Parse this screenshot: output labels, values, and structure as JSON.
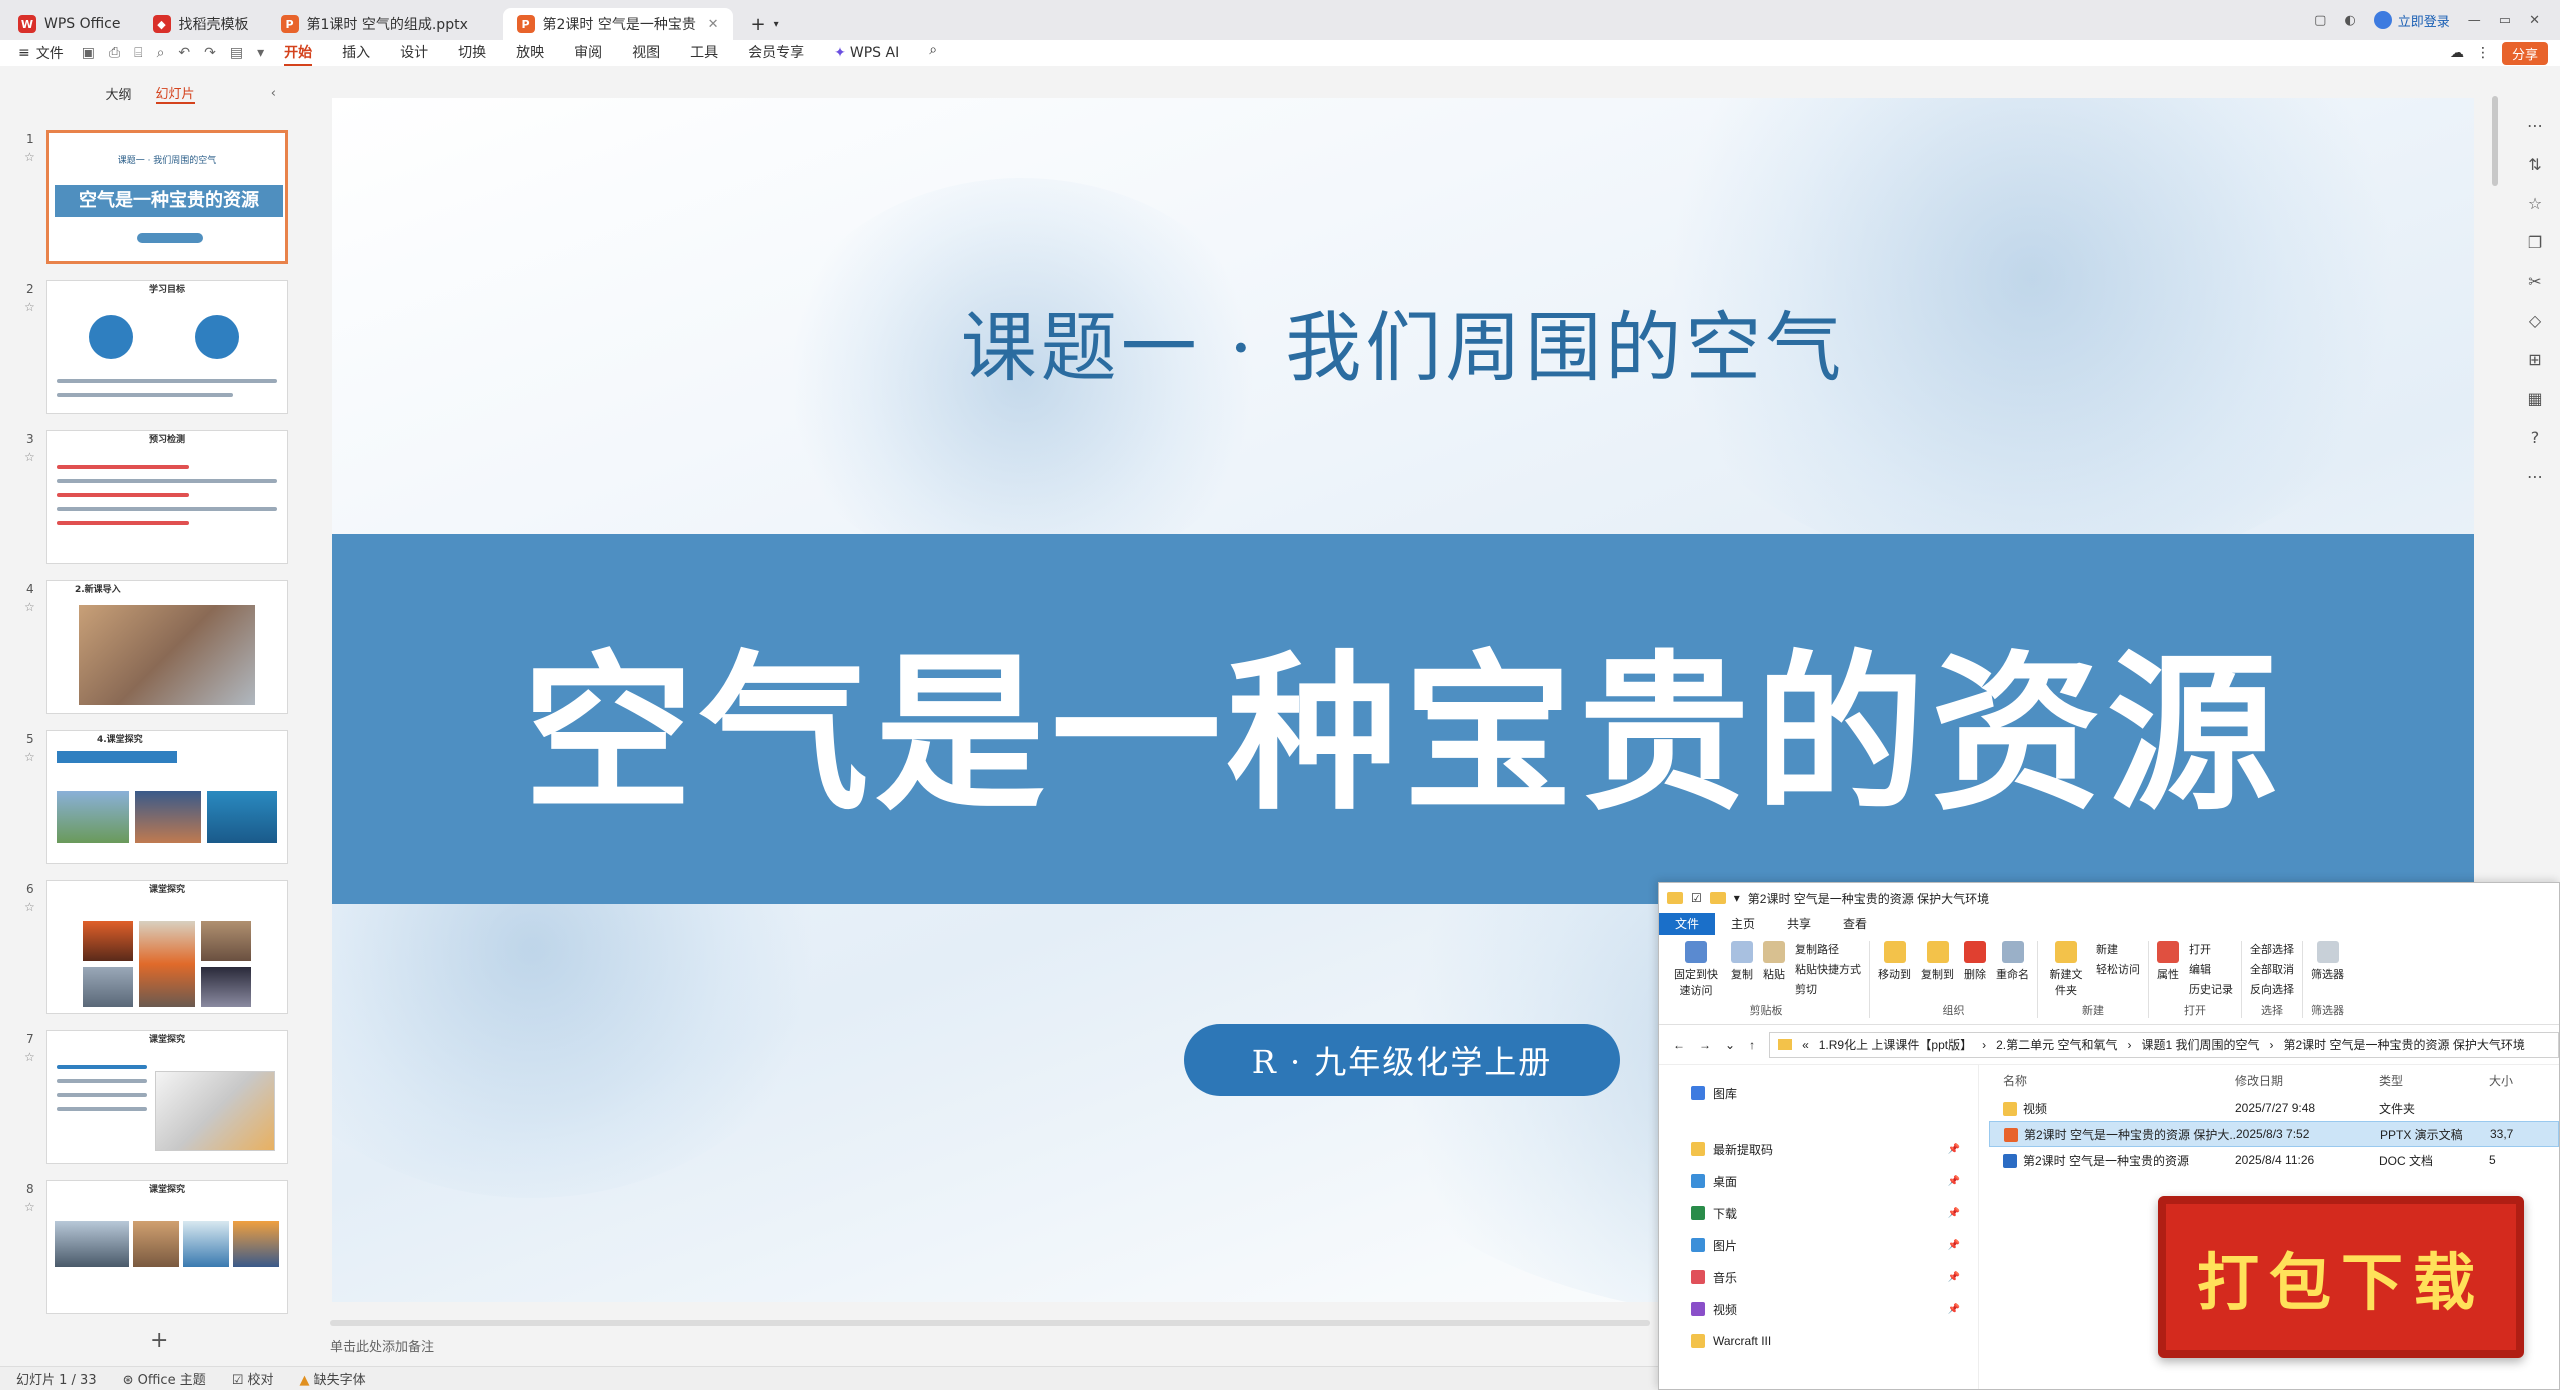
{
  "titlebar": {
    "tabs": [
      {
        "label": "WPS Office",
        "color": "#d9302a",
        "active": false
      },
      {
        "label": "找稻壳模板",
        "color": "#d9302a",
        "active": false
      },
      {
        "label": "第1课时 空气的组成.pptx",
        "color": "#e8632b",
        "active": false
      },
      {
        "label": "第2课时 空气是一种宝贵的资",
        "color": "#e8632b",
        "active": true
      }
    ],
    "new_tab": "+",
    "login": "立即登录"
  },
  "menubar": {
    "file": "文件",
    "tabs": [
      "开始",
      "插入",
      "设计",
      "切换",
      "放映",
      "审阅",
      "视图",
      "工具",
      "会员专享"
    ],
    "active_tab": "开始",
    "ai": "WPS AI",
    "share": "分享"
  },
  "sidebar": {
    "tabs": [
      "大纲",
      "幻灯片"
    ],
    "active": "幻灯片",
    "slides": [
      {
        "num": "1",
        "title": "课题一 · 我们周围的空气",
        "heading": "空气是一种宝贵的资源"
      },
      {
        "num": "2",
        "heading": "学习目标"
      },
      {
        "num": "3",
        "heading": "预习检测"
      },
      {
        "num": "4",
        "heading": "2.新课导入"
      },
      {
        "num": "5",
        "heading": "4.课堂探究"
      },
      {
        "num": "6",
        "heading": "课堂探究"
      },
      {
        "num": "7",
        "heading": "课堂探究"
      },
      {
        "num": "8",
        "heading": "课堂探究"
      }
    ],
    "add": "+"
  },
  "slide": {
    "subtitle": "课题一 · 我们周围的空气",
    "title": "空气是一种宝贵的资源",
    "pill": "R · 九年级化学上册",
    "banner_color": "#4e8fc2",
    "pill_color": "#2d77b7"
  },
  "notes": "单击此处添加备注",
  "statusbar": {
    "page": "幻灯片 1 / 33",
    "theme": "Office 主题",
    "proof": "校对",
    "font": "缺失字体"
  },
  "explorer": {
    "title": "第2课时 空气是一种宝贵的资源 保护大气环境",
    "tabs": [
      "文件",
      "主页",
      "共享",
      "查看"
    ],
    "ribbon": {
      "clipboard": {
        "items": [
          "固定到快速访问",
          "复制",
          "粘贴"
        ],
        "small": [
          "复制路径",
          "粘贴快捷方式",
          "剪切"
        ],
        "label": "剪贴板"
      },
      "organize": {
        "items": [
          "移动到",
          "复制到",
          "删除",
          "重命名"
        ],
        "label": "组织"
      },
      "new": {
        "items": [
          "新建文件夹"
        ],
        "small": [
          "新建",
          "轻松访问"
        ],
        "label": "新建"
      },
      "open": {
        "items": [
          "属性"
        ],
        "small": [
          "打开",
          "编辑",
          "历史记录"
        ],
        "label": "打开"
      },
      "select": {
        "small": [
          "全部选择",
          "全部取消",
          "反向选择"
        ],
        "label": "选择"
      },
      "filter": {
        "items": [
          "筛选器"
        ],
        "label": "筛选器"
      }
    },
    "address": [
      "1.R9化上 上课课件【ppt版】",
      "2.第二单元 空气和氧气",
      "课题1 我们周围的空气",
      "第2课时 空气是一种宝贵的资源 保护大气环境"
    ],
    "nav": [
      {
        "label": "图库",
        "color": "#3d7be0"
      },
      {
        "label": "最新提取码",
        "color": "#f3c24a"
      },
      {
        "label": "桌面",
        "color": "#3b8fd9"
      },
      {
        "label": "下载",
        "color": "#2a8c4a"
      },
      {
        "label": "图片",
        "color": "#3b8fd9"
      },
      {
        "label": "音乐",
        "color": "#e0505a"
      },
      {
        "label": "视频",
        "color": "#8a4fc9"
      },
      {
        "label": "Warcraft III",
        "color": "#f3c24a"
      }
    ],
    "columns": [
      "名称",
      "修改日期",
      "类型",
      "大小"
    ],
    "files": [
      {
        "name": "视频",
        "date": "2025/7/27 9:48",
        "type": "文件夹",
        "size": "",
        "color": "#f3c24a"
      },
      {
        "name": "第2课时 空气是一种宝贵的资源 保护大...",
        "date": "2025/8/3 7:52",
        "type": "PPTX 演示文稿",
        "size": "33,7",
        "color": "#e8632b"
      },
      {
        "name": "第2课时 空气是一种宝贵的资源",
        "date": "2025/8/4 11:26",
        "type": "DOC 文档",
        "size": "5",
        "color": "#2b6cc4"
      }
    ]
  },
  "badge": "打包下载"
}
